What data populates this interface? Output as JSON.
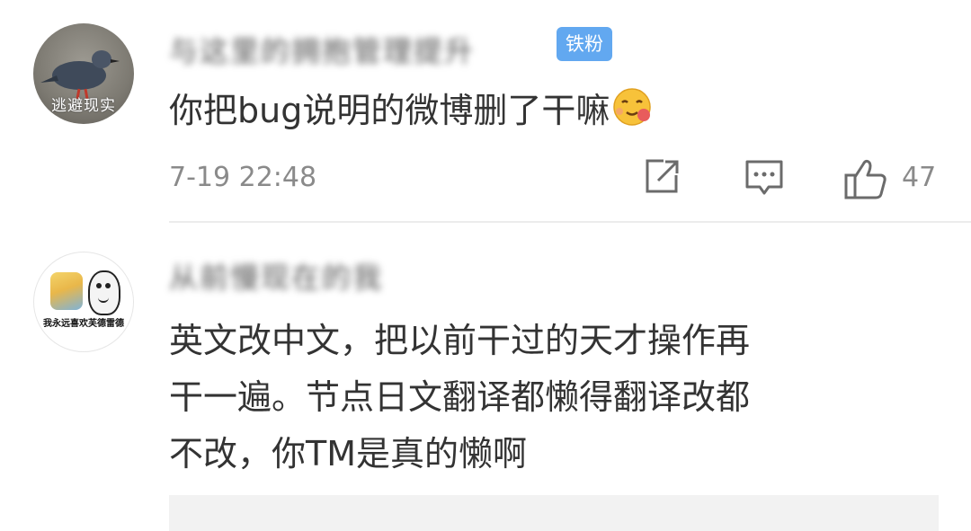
{
  "comments": [
    {
      "username": "与这里的拥抱管理提升",
      "badge": "铁粉",
      "avatar_caption": "逃避现实",
      "text": "你把bug说明的微博删了干嘛",
      "timestamp": "7-19 22:48",
      "likes": "47",
      "icons": [
        "share-icon",
        "reply-icon",
        "like-icon",
        "emoji-icon"
      ]
    },
    {
      "username": "从前慢现在的我",
      "avatar_caption": "我永远喜欢芙德雷德",
      "text_lines": [
        "英文改中文，把以前干过的天才操作再",
        "干一遍。节点日文翻译都懒得翻译改都",
        "不改，你TM是真的懒啊"
      ]
    }
  ],
  "colors": {
    "text": "#333333",
    "meta": "#8a8a8a",
    "badge_bg": "#62a8f0",
    "divider": "#ececec"
  }
}
